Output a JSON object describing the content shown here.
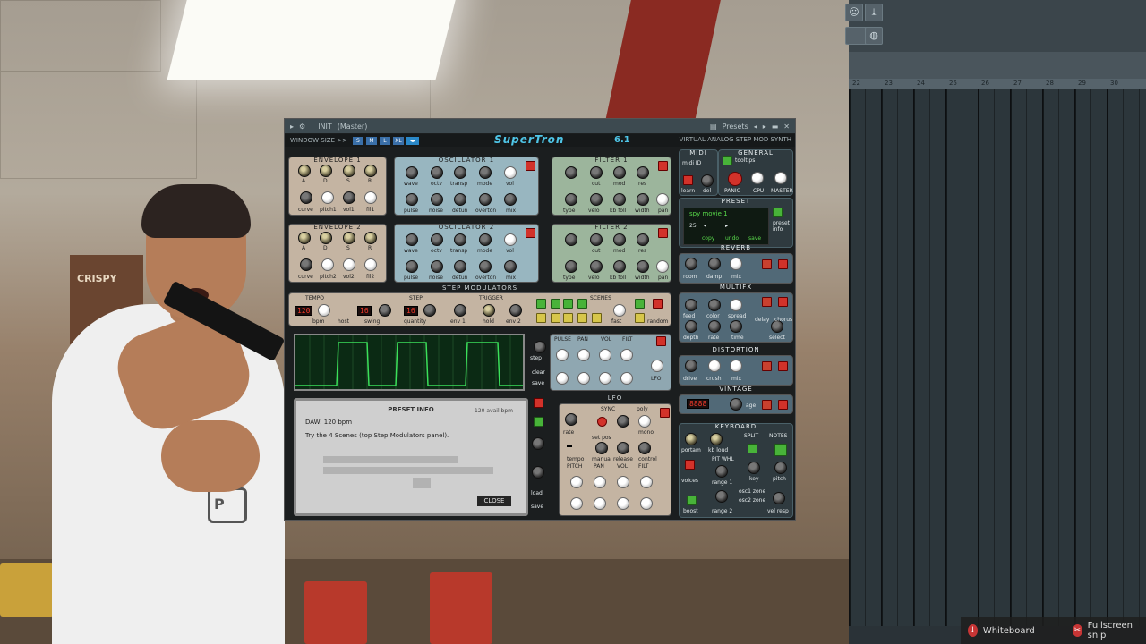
{
  "plugin": {
    "titlebar": {
      "preset_short": "INIT",
      "channel": "(Master)",
      "presets_label": "Presets"
    },
    "header": {
      "window_size_label": "WINDOW SIZE >>",
      "size_buttons": [
        "S",
        "M",
        "L",
        "XL"
      ],
      "logo": "SuperTron",
      "version": "6.1",
      "tagline": "VIRTUAL ANALOG STEP MOD SYNTH"
    },
    "envelope1": {
      "title": "ENVELOPE 1",
      "knobs": [
        "A",
        "D",
        "S",
        "R"
      ],
      "knobs2": [
        "curve",
        "pitch1",
        "vol1",
        "fil1"
      ]
    },
    "envelope2": {
      "title": "ENVELOPE 2",
      "knobs": [
        "A",
        "D",
        "S",
        "R"
      ],
      "knobs2": [
        "curve",
        "pitch2",
        "vol2",
        "fil2"
      ]
    },
    "osc1": {
      "title": "OSCILLATOR 1",
      "row1": [
        "wave",
        "octv",
        "transp",
        "mode",
        "vol"
      ],
      "row2": [
        "pulse",
        "noise",
        "detun",
        "overton",
        "mix"
      ]
    },
    "osc2": {
      "title": "OSCILLATOR 2",
      "row1": [
        "wave",
        "octv",
        "transp",
        "mode",
        "vol"
      ],
      "row2": [
        "pulse",
        "noise",
        "detun",
        "overton",
        "mix"
      ]
    },
    "filter1": {
      "title": "FILTER 1",
      "row1": [
        "cut",
        "mod",
        "res"
      ],
      "row2": [
        "type",
        "velo",
        "kb foll",
        "width",
        "pan"
      ]
    },
    "filter2": {
      "title": "FILTER 2",
      "row1": [
        "cut",
        "mod",
        "res"
      ],
      "row2": [
        "type",
        "velo",
        "kb foll",
        "width",
        "pan"
      ]
    },
    "midi": {
      "title": "MIDI",
      "midi_id_label": "midi ID",
      "learn": "learn",
      "del": "del"
    },
    "general": {
      "title": "GENERAL",
      "tooltips": "tooltips",
      "panic": "PANIC",
      "cpu": "CPU",
      "master": "MASTER"
    },
    "preset": {
      "title": "PRESET",
      "name": "spy movie 1",
      "num": "25",
      "info_label": "preset info",
      "buttons": [
        "copy",
        "undo",
        "save"
      ]
    },
    "step_mod": {
      "title": "STEP MODULATORS",
      "tempo_label": "TEMPO",
      "tempo_value": "120",
      "bpm_label": "bpm",
      "host": "host",
      "swing_value": "16",
      "swing_label": "swing",
      "step_label": "STEP",
      "step_value": "16",
      "quantity": "quantity",
      "env1": "env 1",
      "trigger": "TRIGGER",
      "hold": "hold",
      "env2": "env 2",
      "scenes": "SCENES",
      "fast": "fast",
      "random": "random"
    },
    "lfo_rows": {
      "labels": [
        "PULSE",
        "PAN",
        "VOL",
        "FILT"
      ],
      "lfo": "LFO"
    },
    "side_buttons": [
      "clear",
      "save",
      "step",
      "saver",
      "load",
      "save"
    ],
    "preset_info": {
      "title": "PRESET INFO",
      "daw_line": "DAW: 120 bpm",
      "bpm_note": "120 avail bpm",
      "tip": "Try the 4 Scenes (top Step Modulators panel).",
      "close": "CLOSE"
    },
    "lfo_panel": {
      "title": "LFO",
      "sync": "SYNC",
      "poly": "poly",
      "labels_top": [
        "rate",
        "set pos",
        "mono"
      ],
      "labels_mid": [
        "manual",
        "release",
        "control"
      ],
      "value": "",
      "bottom": [
        "PITCH",
        "PAN",
        "VOL",
        "FILT"
      ],
      "tempo": "tempo"
    },
    "reverb": {
      "title": "REVERB",
      "knobs": [
        "room",
        "damp",
        "mix"
      ]
    },
    "multifx": {
      "title": "MULTIFX",
      "row1": [
        "feed",
        "color",
        "spread"
      ],
      "row2": [
        "depth",
        "rate",
        "time",
        "select"
      ],
      "select_opts": [
        "delay",
        "chorus"
      ]
    },
    "distortion": {
      "title": "DISTORTION",
      "knobs": [
        "drive",
        "crush",
        "mix"
      ]
    },
    "vintage": {
      "title": "VINTAGE",
      "led": "8888",
      "age": "age"
    },
    "keyboard": {
      "title": "KEYBOARD",
      "portam": "portam",
      "kb_loud": "kb loud",
      "split": "SPLIT",
      "notes": "NOTES",
      "key": "key",
      "pitch": "pitch",
      "voices": "voices",
      "boost": "boost",
      "pitch_wheel": "PIT WHL",
      "range1": "range 1",
      "range2": "range 2",
      "osc1": "osc1 zone",
      "osc2": "osc2 zone",
      "vel_resp": "vel resp"
    }
  },
  "daw": {
    "ruler": [
      "22",
      "23",
      "24",
      "25",
      "26",
      "27",
      "28",
      "29",
      "30"
    ],
    "taskbar": [
      "Whiteboard",
      "Fullscreen snip"
    ]
  },
  "colors": {
    "accent": "#4fc6e8",
    "red_button": "#d2322a",
    "green_button": "#48b339",
    "led_red": "#f03a2a",
    "scope_green": "#3be05a"
  },
  "background": {
    "sign": "CRISPY"
  }
}
